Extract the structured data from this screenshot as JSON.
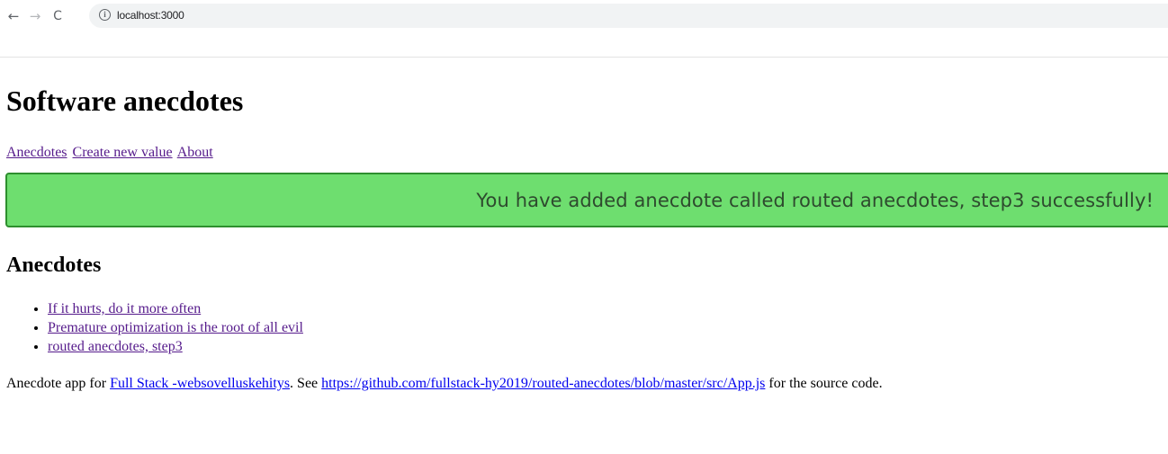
{
  "browser": {
    "url": "localhost:3000",
    "back_glyph": "←",
    "forward_glyph": "→",
    "reload_glyph": "C",
    "info_glyph": "i"
  },
  "header": {
    "title": "Software anecdotes"
  },
  "menu": {
    "anecdotes": "Anecdotes",
    "create_new": "Create new value",
    "about": "About"
  },
  "notification": {
    "message": "You have added anecdote called routed anecdotes, step3 successfully!",
    "background_color": "#6ede6f",
    "border_color": "#2d8f2e"
  },
  "anecdotes": {
    "heading": "Anecdotes",
    "items": [
      "If it hurts, do it more often",
      "Premature optimization is the root of all evil",
      "routed anecdotes, step3"
    ]
  },
  "footer": {
    "prefix": "Anecdote app for ",
    "course_link": "Full Stack -websovelluskehitys",
    "see_text": ". See ",
    "source_link": "https://github.com/fullstack-hy2019/routed-anecdotes/blob/master/src/App.js",
    "suffix": " for the source code."
  }
}
